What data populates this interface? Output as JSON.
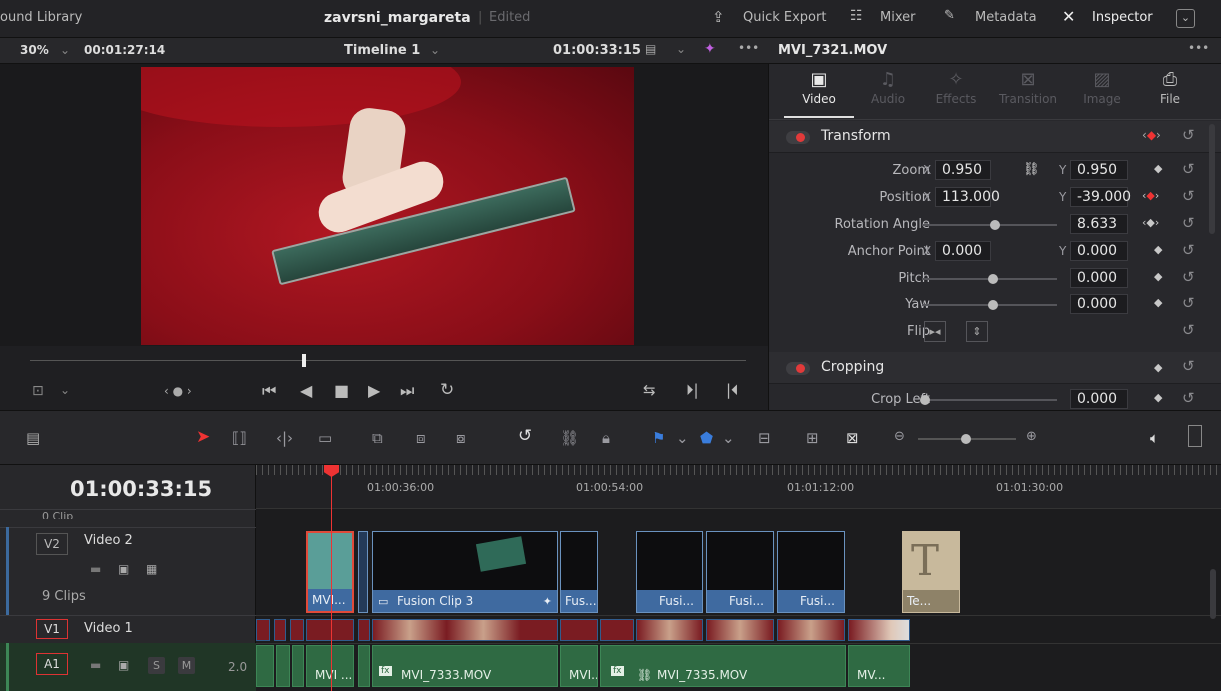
{
  "topbar": {
    "library": "ound Library",
    "project": "zavrsni_margareta",
    "status": "Edited",
    "quick_export": "Quick Export",
    "mixer": "Mixer",
    "metadata": "Metadata",
    "inspector": "Inspector"
  },
  "viewer_bar": {
    "zoom": "30%",
    "duration": "00:01:27:14",
    "timeline": "Timeline 1",
    "timecode": "01:00:33:15",
    "clip_name": "MVI_7321.MOV"
  },
  "inspector": {
    "tabs": [
      {
        "label": "Video",
        "icon": "film-icon"
      },
      {
        "label": "Audio",
        "icon": "music-icon"
      },
      {
        "label": "Effects",
        "icon": "wand-icon"
      },
      {
        "label": "Transition",
        "icon": "transition-icon"
      },
      {
        "label": "Image",
        "icon": "image-icon"
      },
      {
        "label": "File",
        "icon": "camera-icon"
      }
    ],
    "transform_title": "Transform",
    "zoom": {
      "label": "Zoom",
      "x": "0.950",
      "y": "0.950"
    },
    "position": {
      "label": "Position",
      "x": "113.000",
      "y": "-39.000"
    },
    "rotation": {
      "label": "Rotation Angle",
      "value": "8.633"
    },
    "anchor": {
      "label": "Anchor Point",
      "x": "0.000",
      "y": "0.000"
    },
    "pitch": {
      "label": "Pitch",
      "value": "0.000"
    },
    "yaw": {
      "label": "Yaw",
      "value": "0.000"
    },
    "flip": {
      "label": "Flip"
    },
    "cropping_title": "Cropping",
    "crop_left": {
      "label": "Crop Left",
      "value": "0.000"
    },
    "x": "X",
    "y": "Y"
  },
  "timeline": {
    "timecode": "01:00:33:15",
    "ruler": [
      "01:00:36:00",
      "01:00:54:00",
      "01:01:12:00",
      "01:01:30:00"
    ],
    "partial_clips": "0 Clip",
    "v2": {
      "id": "V2",
      "name": "Video 2",
      "clips": "9 Clips"
    },
    "v1": {
      "id": "V1",
      "name": "Video 1"
    },
    "a1": {
      "id": "A1",
      "level": "2.0",
      "solo": "S",
      "mute": "M"
    },
    "v2_clips": [
      "MVI...",
      "Fusion Clip 3",
      "Fus...",
      "Fusi...",
      "Fusi...",
      "Fusi...",
      "Te..."
    ],
    "a1_clips": [
      "MVI ...",
      "MVI_7333.MOV",
      "MVI...",
      "MVI_7335.MOV",
      "MV..."
    ],
    "title_glyph": "T"
  }
}
